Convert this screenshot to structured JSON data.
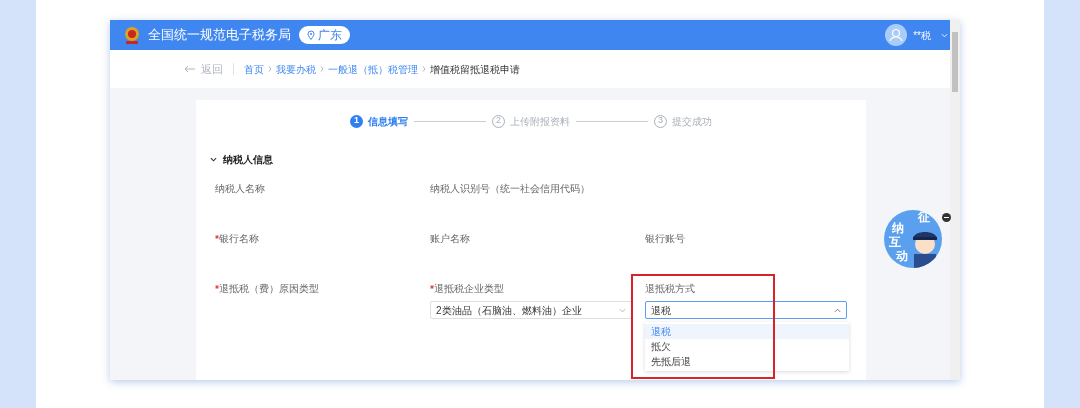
{
  "header": {
    "title": "全国统一规范电子税务局",
    "region": "广东",
    "user": "**税"
  },
  "breadcrumb": {
    "back": "返回",
    "items": [
      {
        "label": "首页",
        "selected": false
      },
      {
        "label": "我要办税",
        "selected": false
      },
      {
        "label": "一般退（抵）税管理",
        "selected": false
      },
      {
        "label": "增值税留抵退税申请",
        "selected": true
      }
    ]
  },
  "steps": [
    {
      "number": "1",
      "label": "信息填写",
      "selected": true
    },
    {
      "number": "2",
      "label": "上传附报资料",
      "selected": false
    },
    {
      "number": "3",
      "label": "提交成功",
      "selected": false
    }
  ],
  "section": {
    "title": "纳税人信息",
    "expanded": true
  },
  "rows": [
    [
      {
        "label": "纳税人名称",
        "required": false
      },
      {
        "label": "纳税人识别号（统一社会信用代码）",
        "required": false
      }
    ],
    [
      {
        "label": "银行名称",
        "required": true
      },
      {
        "label": "账户名称",
        "required": false
      },
      {
        "label": "银行账号",
        "required": false
      }
    ],
    [
      {
        "label": "退抵税（费）原因类型",
        "required": true
      },
      {
        "label": "退抵税企业类型",
        "required": true,
        "value": "2类油品（石脑油、燃料油）企业",
        "expanded": false
      },
      {
        "label": "退抵税方式",
        "required": false,
        "value": "退税",
        "expanded": true,
        "highlighted": true,
        "options": [
          {
            "label": "退税",
            "selected": true
          },
          {
            "label": "抵欠",
            "selected": false
          },
          {
            "label": "先抵后退",
            "selected": false
          }
        ]
      }
    ]
  ],
  "mascot": {
    "chars": [
      "征",
      "纳",
      "互",
      "动"
    ]
  }
}
